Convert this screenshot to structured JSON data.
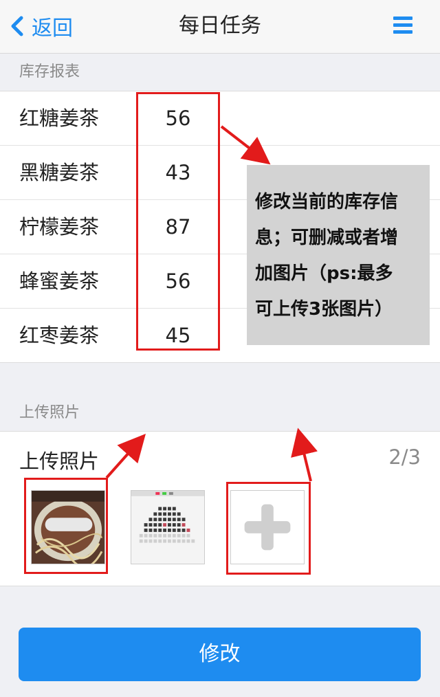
{
  "nav": {
    "back_label": "返回",
    "title": "每日任务"
  },
  "inventory": {
    "section_title": "库存报表",
    "items": [
      {
        "name": "红糖姜茶",
        "count": "56"
      },
      {
        "name": "黑糖姜茶",
        "count": "43"
      },
      {
        "name": "柠檬姜茶",
        "count": "87"
      },
      {
        "name": "蜂蜜姜茶",
        "count": "56"
      },
      {
        "name": "红枣姜茶",
        "count": "45"
      }
    ]
  },
  "annotation": {
    "lines": [
      "修改当前的库存信",
      "息；可删减或者增",
      "加图片（ps:最多",
      "可上传3张图片）"
    ]
  },
  "photos": {
    "section_title": "上传照片",
    "label": "上传照片",
    "count": "2/3"
  },
  "submit_label": "修改",
  "colors": {
    "accent": "#1e8cf0",
    "annotation_red": "#e21b1b",
    "note_bg": "#d3d3d3"
  }
}
